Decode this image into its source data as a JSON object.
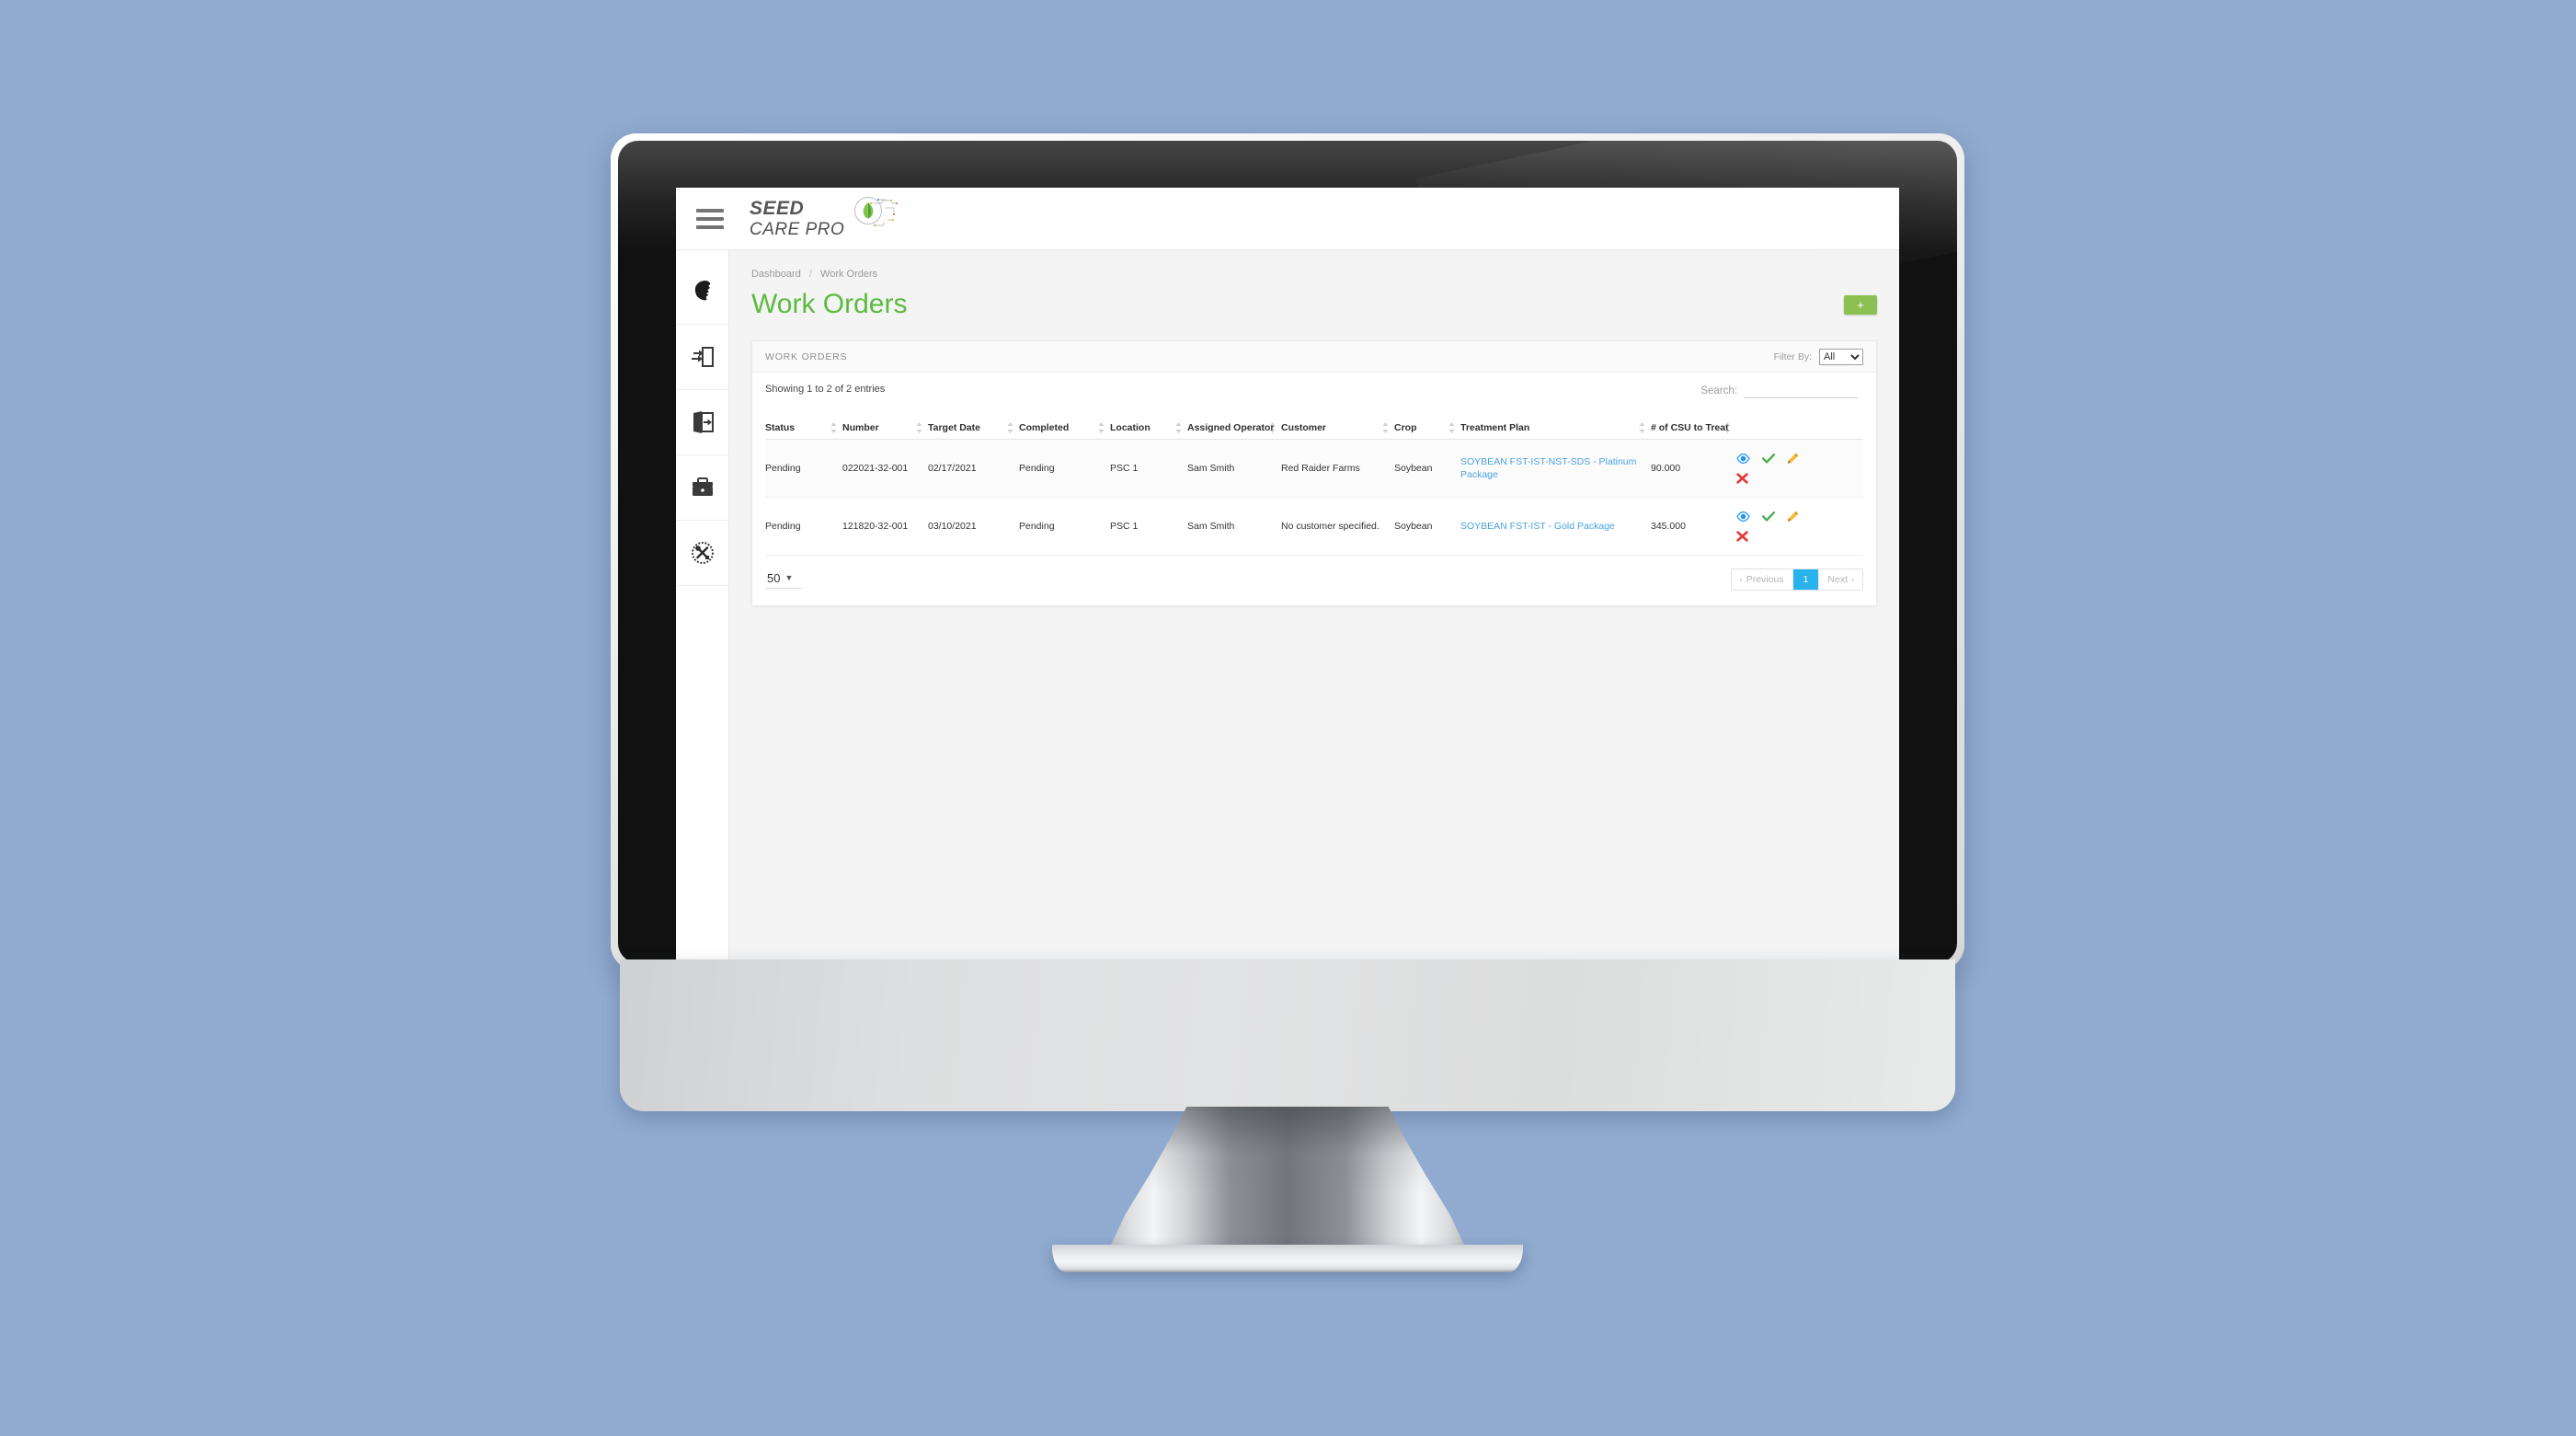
{
  "app": {
    "logo_line1": "SEED",
    "logo_line2": "CARE PRO",
    "menu_icon": "hamburger-icon"
  },
  "sidebar": {
    "items": [
      {
        "icon": "user-profile-icon",
        "label": "Profile"
      },
      {
        "icon": "sign-in-icon",
        "label": "Sign In"
      },
      {
        "icon": "sign-out-icon",
        "label": "Sign Out"
      },
      {
        "icon": "toolbox-icon",
        "label": "Toolbox"
      },
      {
        "icon": "tools-circle-icon",
        "label": "Tools"
      }
    ]
  },
  "breadcrumb": {
    "parent": "Dashboard",
    "separator": "/",
    "current": "Work Orders"
  },
  "page": {
    "title": "Work Orders",
    "add_button_label": "+",
    "accent_green": "#5bbb3e",
    "add_button_color": "#8cc152"
  },
  "card": {
    "title": "WORK ORDERS",
    "filter_label": "Filter By:",
    "filter_value": "All",
    "filter_options": [
      "All"
    ]
  },
  "table": {
    "entries_info": "Showing 1 to 2 of 2 entries",
    "search_label": "Search:",
    "search_value": "",
    "search_placeholder": "",
    "columns": [
      "Status",
      "Number",
      "Target Date",
      "Completed",
      "Location",
      "Assigned Operator",
      "Customer",
      "Crop",
      "Treatment Plan",
      "# of CSU to Treat",
      ""
    ],
    "rows": [
      {
        "status": "Pending",
        "number": "022021-32-001",
        "target_date": "02/17/2021",
        "completed": "Pending",
        "location": "PSC 1",
        "operator": "Sam Smith",
        "customer": "Red Raider Farms",
        "crop": "Soybean",
        "treatment_plan": "SOYBEAN FST-IST-NST-SDS - Platinum Package",
        "csu_to_treat": "90.000",
        "actions": [
          "view-icon",
          "approve-icon",
          "edit-icon",
          "delete-icon"
        ]
      },
      {
        "status": "Pending",
        "number": "121820-32-001",
        "target_date": "03/10/2021",
        "completed": "Pending",
        "location": "PSC 1",
        "operator": "Sam Smith",
        "customer": "No customer specified.",
        "crop": "Soybean",
        "treatment_plan": "SOYBEAN FST-IST - Gold Package",
        "csu_to_treat": "345.000",
        "actions": [
          "view-icon",
          "approve-icon",
          "edit-icon",
          "delete-icon"
        ]
      }
    ]
  },
  "footer": {
    "page_size": "50",
    "page_size_options": [
      "50"
    ],
    "previous_label": "Previous",
    "next_label": "Next",
    "current_page": "1",
    "active_page_color": "#28b3ec"
  },
  "colors": {
    "background": "#90aad0",
    "link_blue": "#4aa3df",
    "action_view": "#2196f3",
    "action_approve": "#4caf50",
    "action_edit": "#f5b932",
    "action_delete": "#e53935"
  }
}
